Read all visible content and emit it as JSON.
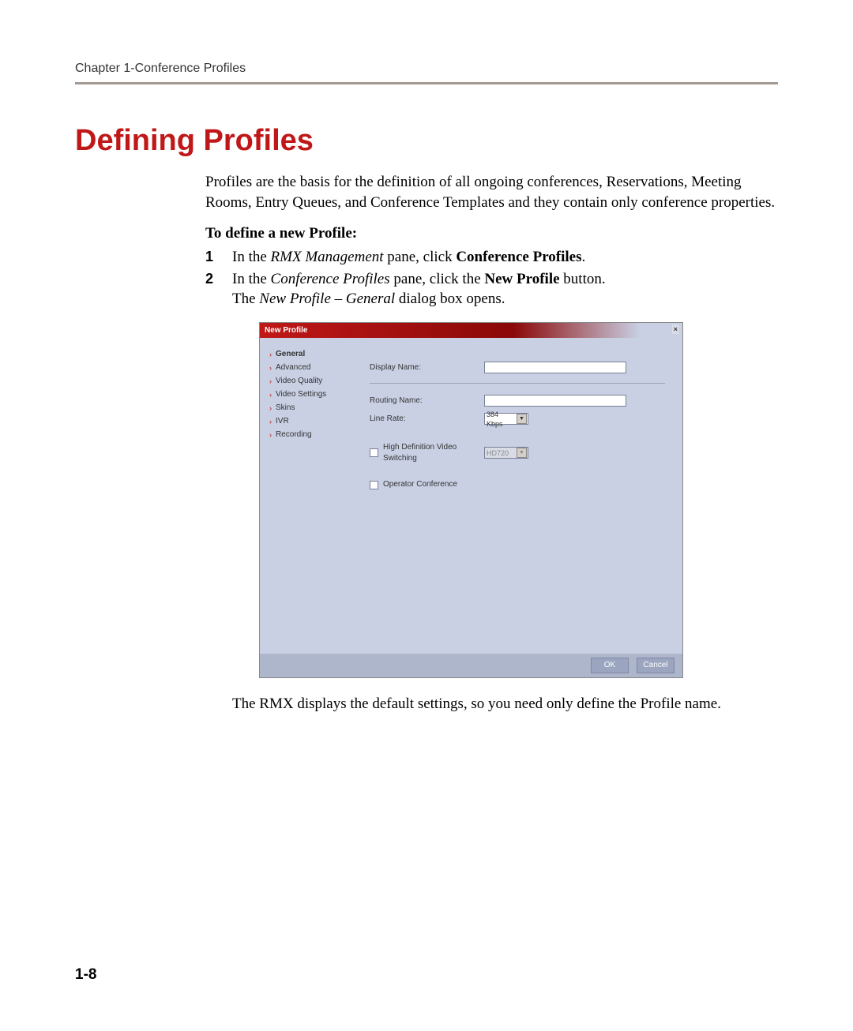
{
  "header": {
    "chapter": "Chapter 1-Conference Profiles"
  },
  "title": "Defining Profiles",
  "intro": "Profiles are the basis for the definition of all ongoing conferences, Reservations, Meeting Rooms, Entry Queues, and Conference Templates and they contain only conference properties.",
  "subhead": "To define a new Profile:",
  "steps": {
    "s1_num": "1",
    "s1_a": "In the ",
    "s1_b": "RMX Management",
    "s1_c": " pane, click ",
    "s1_d": "Conference Profiles",
    "s1_e": ".",
    "s2_num": "2",
    "s2_a": "In the ",
    "s2_b": "Conference Profiles",
    "s2_c": " pane, click the ",
    "s2_d": "New Profile",
    "s2_e": " button.",
    "s2_f": "The ",
    "s2_g": "New Profile – General",
    "s2_h": " dialog box opens."
  },
  "dialog": {
    "title": "New Profile",
    "close": "×",
    "sidebar": {
      "i0": "General",
      "i1": "Advanced",
      "i2": "Video Quality",
      "i3": "Video Settings",
      "i4": "Skins",
      "i5": "IVR",
      "i6": "Recording"
    },
    "form": {
      "display_name_label": "Display Name:",
      "routing_name_label": "Routing Name:",
      "line_rate_label": "Line Rate:",
      "line_rate_value": "384 Kbps",
      "hd_switch_label": "High Definition Video Switching",
      "hd_value": "HD720",
      "operator_label": "Operator Conference"
    },
    "buttons": {
      "ok": "OK",
      "cancel": "Cancel"
    }
  },
  "after": "The RMX displays the default settings, so you need only define the Profile name.",
  "page_num": "1-8"
}
